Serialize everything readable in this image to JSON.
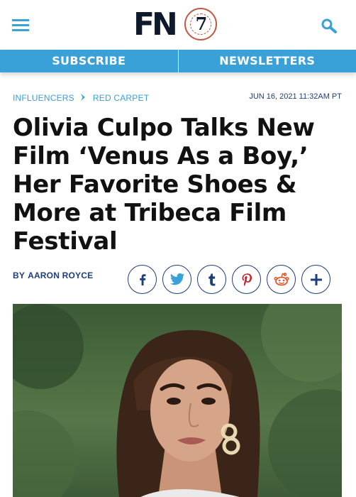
{
  "header": {
    "logo": {
      "text": "FN",
      "seal_number": "7"
    },
    "menu_icon": "hamburger-menu-icon",
    "search_icon": "search-icon"
  },
  "nav": {
    "subscribe_label": "SUBSCRIBE",
    "newsletters_label": "NEWSLETTERS"
  },
  "breadcrumb": {
    "items": [
      "INFLUENCERS",
      "RED CARPET"
    ],
    "separator_icon": "chevron-right-icon"
  },
  "article": {
    "date": "JUN 16, 2021 11:32AM PT",
    "headline": "Olivia Culpo Talks New Film ‘Venus As a Boy,’ Her Favorite Shoes & More at Tribeca Film Festival",
    "byline_prefix": "BY",
    "author": "AARON ROYCE"
  },
  "share": {
    "buttons": [
      {
        "icon": "facebook-icon"
      },
      {
        "icon": "twitter-icon"
      },
      {
        "icon": "tumblr-icon"
      },
      {
        "icon": "pinterest-icon"
      },
      {
        "icon": "reddit-icon"
      },
      {
        "icon": "plus-icon"
      }
    ]
  },
  "colors": {
    "accent": "#3aa0d8",
    "navy": "#1e3d7b",
    "headline": "#111111",
    "logo_ring": "#c25a44"
  }
}
